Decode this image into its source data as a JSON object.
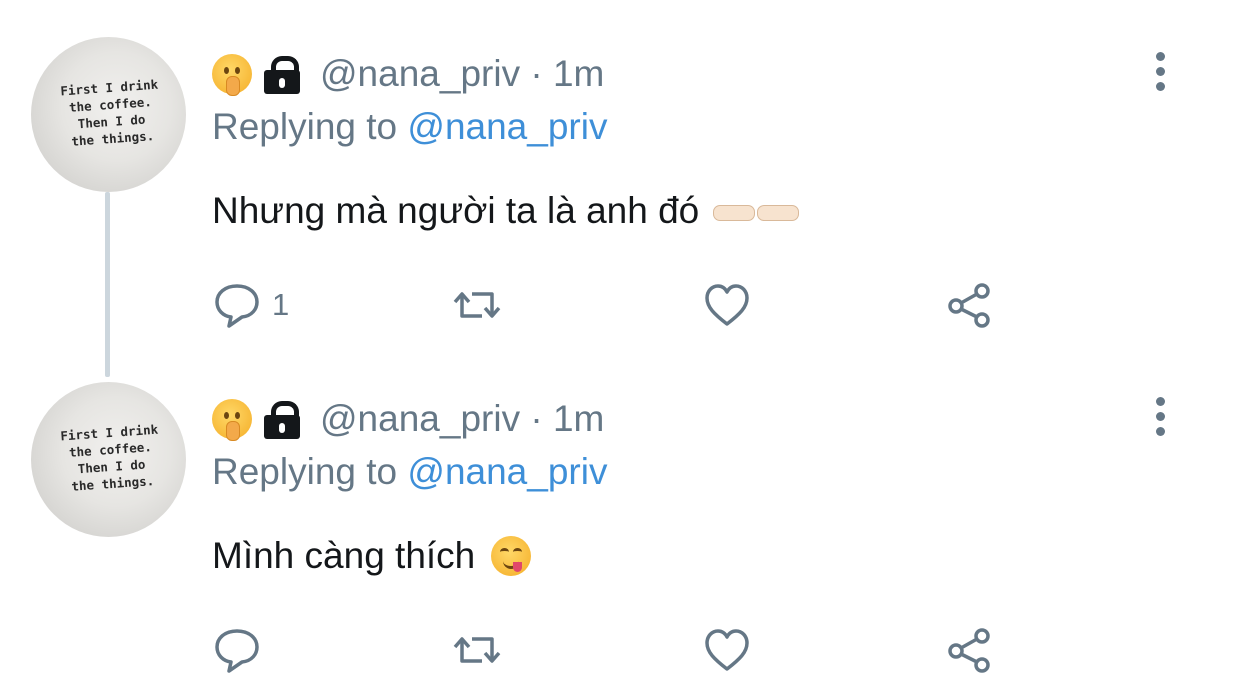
{
  "tweets": [
    {
      "avatar_text": [
        "First I drink",
        "the coffee.",
        "Then I do",
        "the things."
      ],
      "handle": "@nana_priv",
      "time_separator": "·",
      "time": "1m",
      "replying_label": "Replying to",
      "replying_mention": "@nana_priv",
      "text": "Nhưng mà người ta là anh đó",
      "reply_count": "1",
      "retweet_count": "",
      "like_count": ""
    },
    {
      "avatar_text": [
        "First I drink",
        "the coffee.",
        "Then I do",
        "the things."
      ],
      "handle": "@nana_priv",
      "time_separator": "·",
      "time": "1m",
      "replying_label": "Replying to",
      "replying_mention": "@nana_priv",
      "text": "Mình càng thích",
      "reply_count": "",
      "retweet_count": "",
      "like_count": ""
    }
  ],
  "colors": {
    "secondary_text": "#657786",
    "mention": "#3e8fd8",
    "primary_text": "#14171a",
    "thread_line": "#ccd6dd"
  },
  "icons": [
    "shushing-face-emoji",
    "lock-icon",
    "more-vertical-icon",
    "reply-icon",
    "retweet-icon",
    "like-icon",
    "share-icon",
    "pointing-hands-emoji",
    "yum-face-emoji"
  ]
}
